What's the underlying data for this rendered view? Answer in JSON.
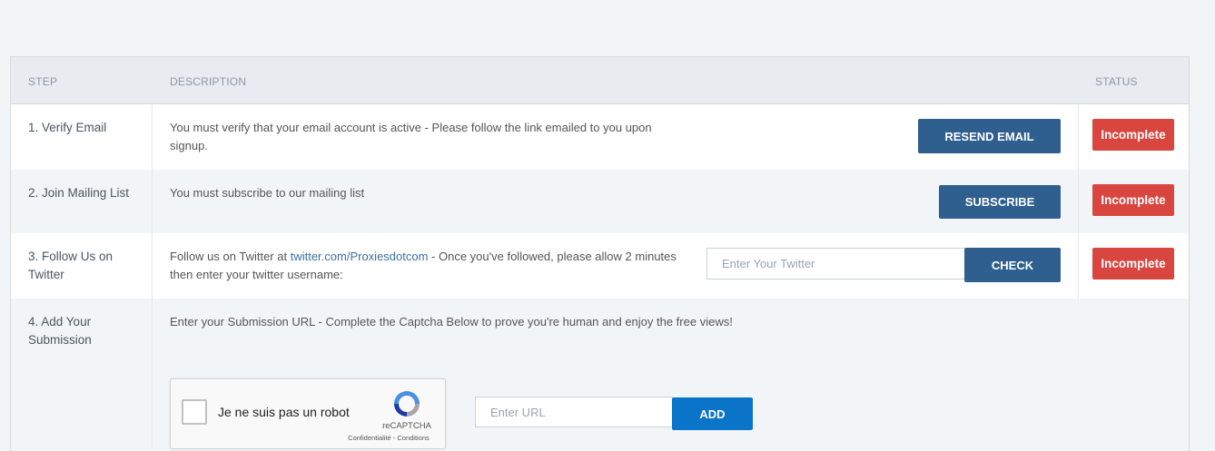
{
  "table": {
    "headers": {
      "step": "STEP",
      "description": "DESCRIPTION",
      "status": "STATUS"
    },
    "rows": [
      {
        "step": "1. Verify Email",
        "description": "You must verify that your email account is active - Please follow the link emailed to you upon signup.",
        "button": "RESEND EMAIL",
        "status": "Incomplete"
      },
      {
        "step": "2. Join Mailing List",
        "description": "You must subscribe to our mailing list",
        "button": "SUBSCRIBE",
        "status": "Incomplete"
      },
      {
        "step": "3. Follow Us on Twitter",
        "description_prefix": "Follow us on Twitter at ",
        "description_link": "twitter.com/Proxiesdotcom",
        "description_suffix": " - Once you've followed, please allow 2 minutes then enter your twitter username:",
        "input_placeholder": "Enter Your Twitter",
        "button": "CHECK",
        "status": "Incomplete"
      },
      {
        "step": "4. Add Your Submission",
        "description": "Enter your Submission URL - Complete the Captcha Below to prove you're human and enjoy the free views!",
        "input_placeholder": "Enter URL",
        "button": "ADD"
      }
    ]
  },
  "captcha": {
    "label": "Je ne suis pas un robot",
    "brand": "reCAPTCHA",
    "links": "Confidentialité - Conditions",
    "icon": "recaptcha-icon"
  },
  "colors": {
    "primary_button": "#2f5f8f",
    "add_button": "#0a74c9",
    "incomplete_badge": "#d9463f",
    "link": "#3a6ea5"
  }
}
